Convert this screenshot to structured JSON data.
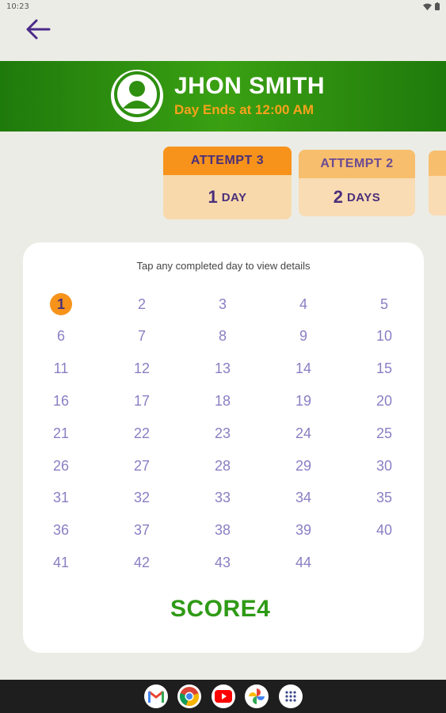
{
  "status_bar": {
    "time": "10:23"
  },
  "user": {
    "name": "JHON SMITH",
    "day_ends": "Day Ends at 12:00 AM"
  },
  "attempts": [
    {
      "label": "ATTEMPT 3",
      "count": "1",
      "unit": "DAY",
      "active": true
    },
    {
      "label": "ATTEMPT 2",
      "count": "2",
      "unit": "DAYS",
      "active": false
    }
  ],
  "calendar": {
    "hint": "Tap any completed day to view details",
    "days": [
      "1",
      "2",
      "3",
      "4",
      "5",
      "6",
      "7",
      "8",
      "9",
      "10",
      "11",
      "12",
      "13",
      "14",
      "15",
      "16",
      "17",
      "18",
      "19",
      "20",
      "21",
      "22",
      "23",
      "24",
      "25",
      "26",
      "27",
      "28",
      "29",
      "30",
      "31",
      "32",
      "33",
      "34",
      "35",
      "36",
      "37",
      "38",
      "39",
      "40",
      "41",
      "42",
      "43",
      "44"
    ],
    "completed": [
      "1"
    ]
  },
  "logo": {
    "text": "SCORE4"
  },
  "colors": {
    "header_green": "#2e8f10",
    "accent_orange": "#f7931b",
    "name_white": "#ffffff",
    "day_ends_orange": "#f7a21b",
    "purple_text": "#4a2f7a",
    "day_number": "#8a7fc3"
  },
  "dock": [
    "gmail-icon",
    "chrome-icon",
    "youtube-icon",
    "photos-icon",
    "apps-grid-icon"
  ]
}
